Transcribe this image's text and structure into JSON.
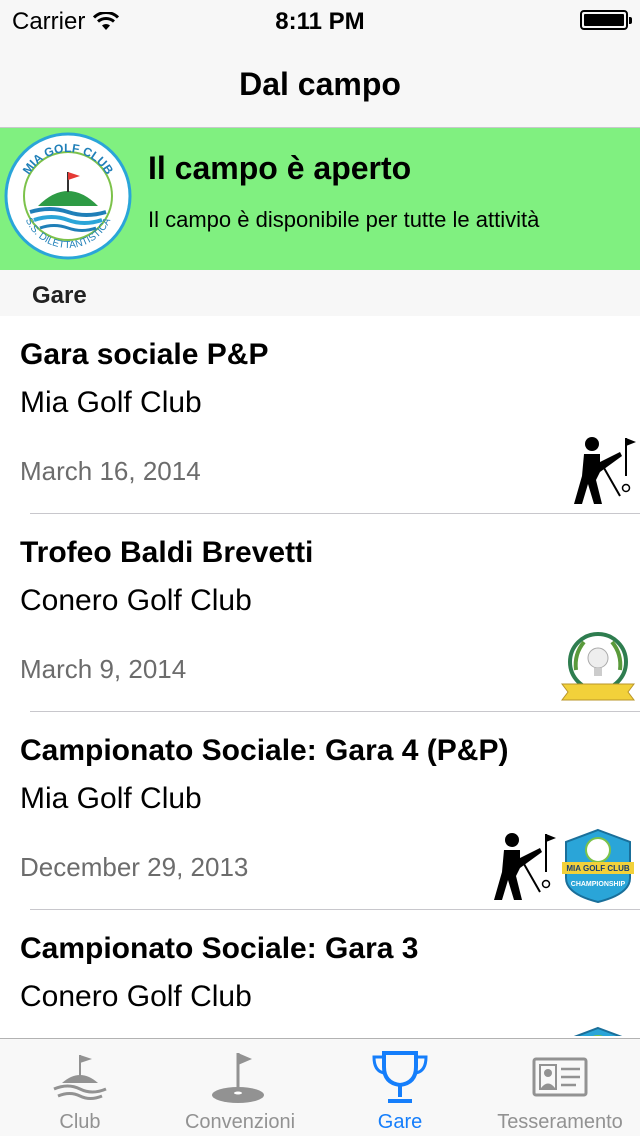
{
  "status_bar": {
    "carrier": "Carrier",
    "time": "8:11 PM"
  },
  "nav": {
    "title": "Dal campo"
  },
  "banner": {
    "title": "Il campo è aperto",
    "text": "Il campo è disponibile per tutte le attività",
    "logo_top_text": "MIA GOLF CLUB",
    "logo_bottom_text": "S.S. DILETTANTISTICA",
    "color": "#80f080"
  },
  "section": {
    "label": "Gare"
  },
  "events": [
    {
      "name": "Gara sociale P&P",
      "club": "Mia Golf Club",
      "date": "March 16, 2014",
      "icons": [
        "golfer-icon"
      ]
    },
    {
      "name": "Trofeo Baldi Brevetti",
      "club": "Conero Golf Club",
      "date": "March 9, 2014",
      "icons": [
        "trophy-emblem-icon"
      ]
    },
    {
      "name": "Campionato Sociale: Gara 4 (P&P)",
      "club": "Mia Golf Club",
      "date": "December 29, 2013",
      "icons": [
        "golfer-icon",
        "championship-icon"
      ]
    },
    {
      "name": "Campionato Sociale: Gara 3",
      "club": "Conero Golf Club",
      "date": "",
      "icons": [
        "championship-icon"
      ]
    }
  ],
  "championship_badge": {
    "top": "MIA GOLF CLUB",
    "bottom": "CHAMPIONSHIP"
  },
  "tabs": [
    {
      "label": "Club",
      "icon": "island-flag-icon",
      "active": false
    },
    {
      "label": "Convenzioni",
      "icon": "green-flag-icon",
      "active": false
    },
    {
      "label": "Gare",
      "icon": "trophy-icon",
      "active": true
    },
    {
      "label": "Tesseramento",
      "icon": "member-card-icon",
      "active": false
    }
  ],
  "colors": {
    "accent": "#157efb",
    "inactive_tab": "#929292"
  }
}
